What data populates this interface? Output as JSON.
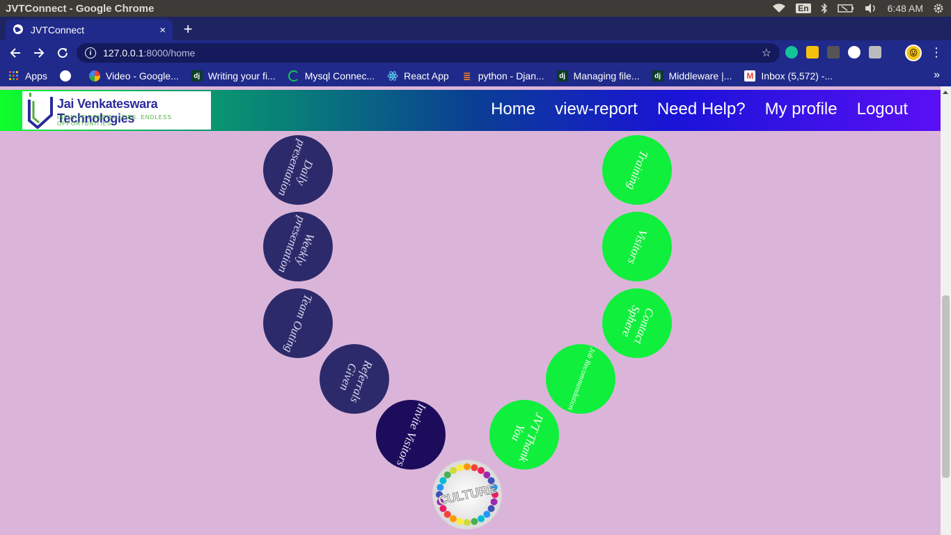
{
  "os": {
    "window_title": "JVTConnect - Google Chrome",
    "lang": "En",
    "time": "6:48 AM"
  },
  "browser": {
    "tab_title": "JVTConnect",
    "tab_close": "×",
    "new_tab": "+",
    "url_host": "127.0.0.1",
    "url_path": ":8000/home",
    "bookmarks": [
      {
        "label": "Apps",
        "icon": "apps-grid-icon"
      },
      {
        "label": "",
        "icon": "globe-icon"
      },
      {
        "label": "Video - Google...",
        "icon": "google-video-icon"
      },
      {
        "label": "Writing your fi...",
        "icon": "django-icon"
      },
      {
        "label": "Mysql Connec...",
        "icon": "mysql-loading-icon"
      },
      {
        "label": "React App",
        "icon": "react-icon"
      },
      {
        "label": "python - Djan...",
        "icon": "stackoverflow-icon"
      },
      {
        "label": "Managing file...",
        "icon": "django-icon"
      },
      {
        "label": "Middleware |...",
        "icon": "django-icon"
      },
      {
        "label": "Inbox (5,572) -...",
        "icon": "gmail-icon"
      }
    ],
    "more": "»"
  },
  "header": {
    "logo_name": "Jai Venkateswara Technologies",
    "logo_tag": "INFINITE POSSIBILITIES. ENDLESS OPPORTUNITIES.",
    "nav": [
      "Home",
      "view-report",
      "Need Help?",
      "My profile",
      "Logout"
    ]
  },
  "circles": {
    "left": [
      "Daily presentation",
      "Weekly presentation",
      "Team Outing",
      "Referrals Given",
      "Invite Visitors"
    ],
    "right": [
      "Training",
      "Visitors",
      "Contact Sphere",
      "Job Recommendation",
      "JVT Thank You"
    ],
    "center": "CULTURE"
  },
  "colors": {
    "dark_circle": "#2d2a6b",
    "darker_circle": "#1d0c5c",
    "green_circle": "#10ef3c",
    "page_bg": "#dbb5d9"
  }
}
